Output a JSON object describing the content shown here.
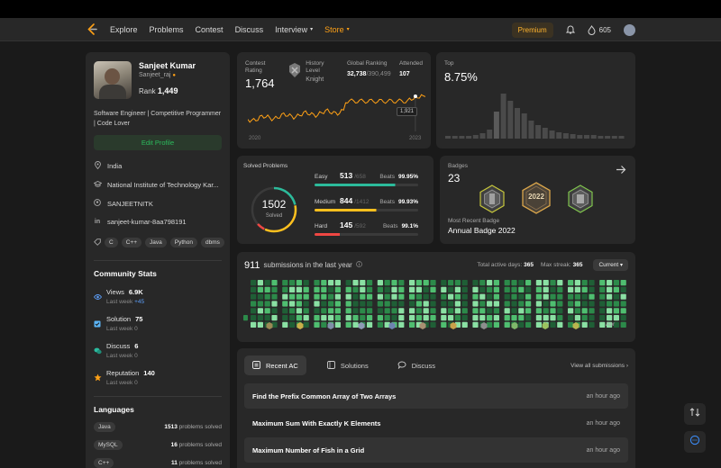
{
  "nav": {
    "items": [
      "Explore",
      "Problems",
      "Contest",
      "Discuss"
    ],
    "interview": "Interview",
    "store": "Store",
    "premium": "Premium",
    "streak_count": "605",
    "accent": "#ffa116"
  },
  "profile": {
    "name": "Sanjeet Kumar",
    "handle": "Sanjeet_raj",
    "rank_label": "Rank",
    "rank_value": "1,449",
    "bio": "Software Engineer | Competitive Programmer | Code Lover",
    "edit_label": "Edit Profile",
    "location": "India",
    "school": "National Institute of Technology Kar...",
    "github": "SANJEETNITK",
    "linkedin": "sanjeet-kumar-8aa798191",
    "skills": [
      "C",
      "C++",
      "Java",
      "Python",
      "dbms"
    ]
  },
  "community": {
    "title": "Community Stats",
    "stats": [
      {
        "label": "Views",
        "value": "6.9K",
        "sub": "Last week",
        "delta": "+45",
        "color": "#5b9cf5"
      },
      {
        "label": "Solution",
        "value": "75",
        "sub": "Last week",
        "delta": "0",
        "color": "#5bb4f5"
      },
      {
        "label": "Discuss",
        "value": "6",
        "sub": "Last week",
        "delta": "0",
        "color": "#2bbca0"
      },
      {
        "label": "Reputation",
        "value": "140",
        "sub": "Last week",
        "delta": "0",
        "color": "#ffa116"
      }
    ]
  },
  "languages": {
    "title": "Languages",
    "items": [
      {
        "name": "Java",
        "count": "1513",
        "unit": "problems solved"
      },
      {
        "name": "MySQL",
        "count": "16",
        "unit": "problems solved"
      },
      {
        "name": "C++",
        "count": "11",
        "unit": "problems solved"
      }
    ]
  },
  "contest": {
    "rating_label": "Contest Rating",
    "rating": "1,764",
    "level_label": "History Level",
    "level": "Knight",
    "global_label": "Global Ranking",
    "global_rank": "32,738",
    "global_total": "/390,499",
    "attended_label": "Attended",
    "attended": "107",
    "year_start": "2020",
    "year_end": "2023",
    "tooltip": "1,921",
    "top_label": "Top",
    "top_value": "8.75%",
    "line_color": "#ffa116"
  },
  "solved": {
    "title": "Solved Problems",
    "total": "1502",
    "total_label": "Solved",
    "beats_label": "Beats",
    "rows": [
      {
        "name": "Easy",
        "count": 513,
        "total": 658,
        "beats": "99.95%",
        "color": "#2cbb9b"
      },
      {
        "name": "Medium",
        "count": 844,
        "total": 1412,
        "beats": "99.93%",
        "color": "#ffc01e"
      },
      {
        "name": "Hard",
        "count": 145,
        "total": 592,
        "beats": "99.1%",
        "color": "#ef4743"
      }
    ]
  },
  "badges": {
    "title": "Badges",
    "count": "23",
    "recent_label": "Most Recent Badge",
    "recent_name": "Annual Badge 2022",
    "badge_year": "2022"
  },
  "submissions": {
    "count": "911",
    "label": "submissions in the last year",
    "active_label": "Total active days:",
    "active_days": "365",
    "streak_label": "Max streak:",
    "max_streak": "365",
    "current": "Current",
    "month_label": "Apr"
  },
  "recent": {
    "tabs": [
      "Recent AC",
      "Solutions",
      "Discuss"
    ],
    "view_all": "View all submissions",
    "items": [
      {
        "title": "Find the Prefix Common Array of Two Arrays",
        "time": "an hour ago"
      },
      {
        "title": "Maximum Sum With Exactly K Elements",
        "time": "an hour ago"
      },
      {
        "title": "Maximum Number of Fish in a Grid",
        "time": "an hour ago"
      }
    ]
  }
}
